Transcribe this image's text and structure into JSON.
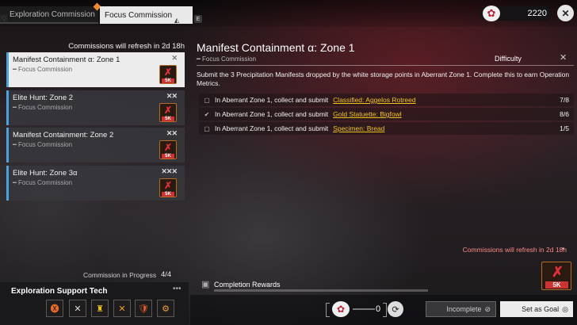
{
  "tabs": {
    "key_left": "Q",
    "key_right": "E",
    "exploration_label": "Exploration Commission",
    "focus_label": "Focus Commission"
  },
  "currency": {
    "value": "2220",
    "icon": "flower-icon"
  },
  "close_glyph": "✕",
  "sidebar": {
    "refresh_text": "Commissions will refresh in 2d 18h",
    "cards": [
      {
        "title": "Manifest Containment α: Zone 1",
        "subtitle": "Focus Commission",
        "rank": "✕",
        "reward_label": "5K"
      },
      {
        "title": "Elite Hunt: Zone 2",
        "subtitle": "Focus Commission",
        "rank": "✕✕",
        "reward_label": "5K"
      },
      {
        "title": "Manifest Containment: Zone 2",
        "subtitle": "Focus Commission",
        "rank": "✕✕",
        "reward_label": "5K"
      },
      {
        "title": "Elite Hunt: Zone 3α",
        "subtitle": "Focus Commission",
        "rank": "✕✕✕",
        "reward_label": "5K"
      }
    ],
    "progress_label": "Commission in Progress",
    "progress_value": "4/4"
  },
  "tech": {
    "title": "Exploration Support Tech",
    "more": "•••",
    "slots": [
      "🅧",
      "✕",
      "♜",
      "✕",
      "🛡",
      "⚙"
    ]
  },
  "main": {
    "title": "Manifest Containment α: Zone 1",
    "subtitle": "Focus Commission",
    "difficulty_label": "Difficulty",
    "difficulty_icon": "✕",
    "description": "Submit the 3 Precipitation Manifests dropped by the white storage points in Aberrant Zone 1. Complete this to earn Operation Metrics.",
    "objectives": [
      {
        "check": "▢",
        "text": "In Aberrant Zone 1, collect and submit",
        "item": "Classified: Aggelos Rotreed",
        "progress": "7/8"
      },
      {
        "check": "✔",
        "text": "In Aberrant Zone 1, collect and submit",
        "item": "Gold Statuette: Bigfowl",
        "progress": "8/6"
      },
      {
        "check": "▢",
        "text": "In Aberrant Zone 1, collect and submit",
        "item": "Specimen: Bread",
        "progress": "1/5"
      }
    ],
    "refresh_text": "Commissions will refresh in 2d 18h",
    "reward_label": "5K",
    "rewards_label": "Completion Rewards"
  },
  "footer": {
    "cost_value": "0",
    "incomplete_label": "Incomplete",
    "goal_label": "Set as Goal"
  }
}
